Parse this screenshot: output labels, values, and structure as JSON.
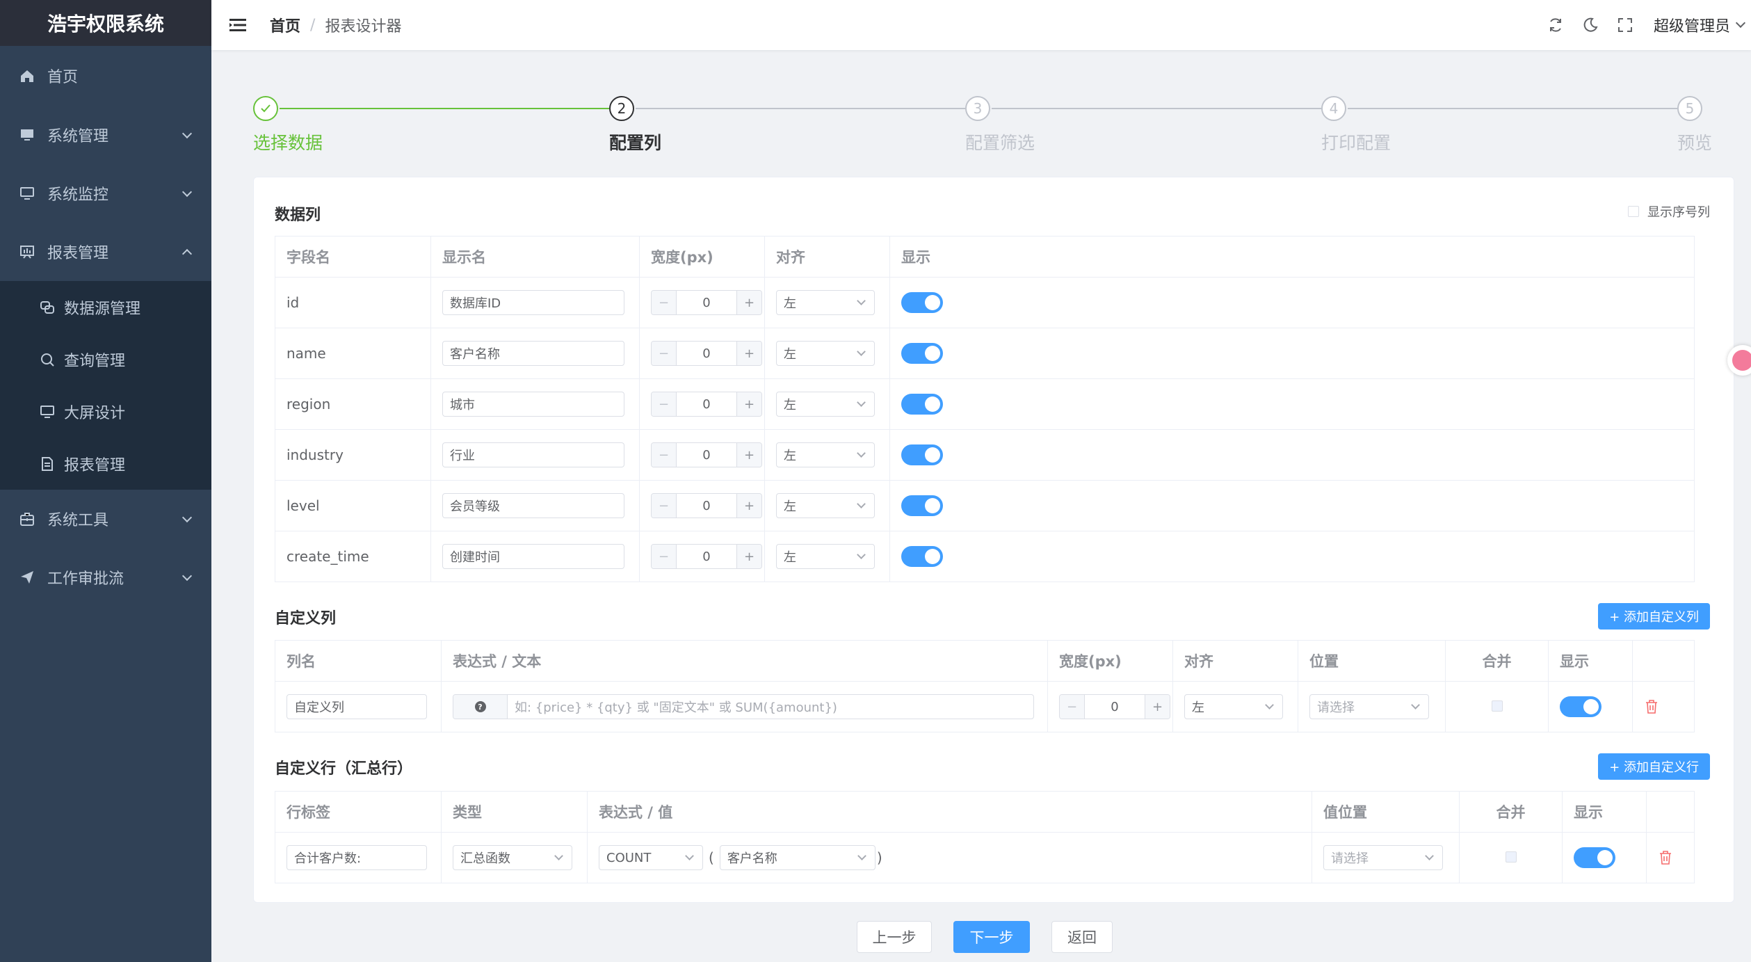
{
  "app": {
    "title": "浩宇权限系统"
  },
  "sidebar": {
    "items": [
      {
        "label": "首页",
        "icon": "home-icon"
      },
      {
        "label": "系统管理",
        "icon": "monitor-icon"
      },
      {
        "label": "系统监控",
        "icon": "screen-icon"
      },
      {
        "label": "报表管理",
        "icon": "chart-icon"
      },
      {
        "label": "系统工具",
        "icon": "toolbox-icon"
      },
      {
        "label": "工作审批流",
        "icon": "send-icon"
      }
    ],
    "sub_items": [
      {
        "label": "数据源管理",
        "icon": "datasource-icon"
      },
      {
        "label": "查询管理",
        "icon": "search-icon"
      },
      {
        "label": "大屏设计",
        "icon": "screen-icon"
      },
      {
        "label": "报表管理",
        "icon": "document-icon"
      }
    ]
  },
  "header": {
    "breadcrumb": {
      "home": "首页",
      "separator": "/",
      "current": "报表设计器"
    },
    "user": "超级管理员"
  },
  "steps": [
    {
      "num": "✓",
      "label": "选择数据",
      "status": "done"
    },
    {
      "num": "2",
      "label": "配置列",
      "status": "active"
    },
    {
      "num": "3",
      "label": "配置筛选",
      "status": "wait"
    },
    {
      "num": "4",
      "label": "打印配置",
      "status": "wait"
    },
    {
      "num": "5",
      "label": "预览",
      "status": "wait"
    }
  ],
  "data_columns": {
    "title": "数据列",
    "show_index_label": "显示序号列",
    "headers": {
      "field": "字段名",
      "display": "显示名",
      "width": "宽度(px)",
      "align": "对齐",
      "visible": "显示"
    },
    "rows": [
      {
        "field": "id",
        "display": "数据库ID",
        "width": "0",
        "align": "左",
        "visible": true
      },
      {
        "field": "name",
        "display": "客户名称",
        "width": "0",
        "align": "左",
        "visible": true
      },
      {
        "field": "region",
        "display": "城市",
        "width": "0",
        "align": "左",
        "visible": true
      },
      {
        "field": "industry",
        "display": "行业",
        "width": "0",
        "align": "左",
        "visible": true
      },
      {
        "field": "level",
        "display": "会员等级",
        "width": "0",
        "align": "左",
        "visible": true
      },
      {
        "field": "create_time",
        "display": "创建时间",
        "width": "0",
        "align": "左",
        "visible": true
      }
    ]
  },
  "custom_columns": {
    "title": "自定义列",
    "add_label": "+ 添加自定义列",
    "headers": {
      "name": "列名",
      "expr": "表达式 / 文本",
      "width": "宽度(px)",
      "align": "对齐",
      "position": "位置",
      "merge": "合并",
      "visible": "显示"
    },
    "row": {
      "name": "自定义列",
      "expr_placeholder": "如: {price} * {qty} 或 \"固定文本\" 或 SUM({amount})",
      "width": "0",
      "align": "左",
      "position_placeholder": "请选择"
    }
  },
  "custom_rows": {
    "title": "自定义行（汇总行）",
    "add_label": "+ 添加自定义行",
    "headers": {
      "label": "行标签",
      "type": "类型",
      "expr": "表达式 / 值",
      "position": "值位置",
      "merge": "合并",
      "visible": "显示"
    },
    "row": {
      "label": "合计客户数:",
      "type": "汇总函数",
      "func": "COUNT",
      "open_paren": "(",
      "field": "客户名称",
      "close_paren": ")",
      "position_placeholder": "请选择"
    }
  },
  "footer": {
    "prev": "上一步",
    "next": "下一步",
    "back": "返回"
  },
  "colors": {
    "primary": "#409eff",
    "success": "#67c23a",
    "sidebar": "#304156"
  }
}
